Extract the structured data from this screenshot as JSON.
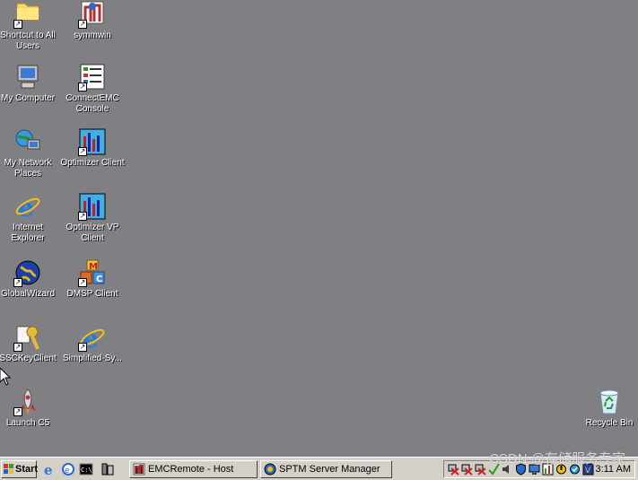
{
  "desktop": {
    "icons": [
      {
        "label": "Shortcut to All Users",
        "icon": "folder-icon"
      },
      {
        "label": "symmwin",
        "icon": "symmwin-icon"
      },
      {
        "label": "My Computer",
        "icon": "computer-icon"
      },
      {
        "label": "ConnectEMC Console",
        "icon": "console-icon"
      },
      {
        "label": "My Network Places",
        "icon": "network-icon"
      },
      {
        "label": "Optimizer Client",
        "icon": "bar-chart-icon"
      },
      {
        "label": "Internet Explorer",
        "icon": "ie-icon"
      },
      {
        "label": "Optimizer VP Client",
        "icon": "bar-chart-icon"
      },
      {
        "label": "GlobalWizard",
        "icon": "globe-icon"
      },
      {
        "label": "DMSP Client",
        "icon": "blocks-icon"
      },
      {
        "label": "SSCKeyClient",
        "icon": "key-icon"
      },
      {
        "label": "Simplified-Sy...",
        "icon": "ie-icon"
      },
      {
        "label": "Launch C5",
        "icon": "rocket-icon"
      },
      {
        "label": "Recycle Bin",
        "icon": "recycle-bin-icon"
      }
    ]
  },
  "taskbar": {
    "start_label": "Start",
    "tasks": [
      {
        "label": "EMCRemote - Host"
      },
      {
        "label": "SPTM Server Manager"
      }
    ],
    "clock": "3:11 AM"
  },
  "watermark": "CSDN @存储服务专家",
  "colors": {
    "desktop_bg": "#808084",
    "taskbar_bg": "#d4d0c8"
  }
}
